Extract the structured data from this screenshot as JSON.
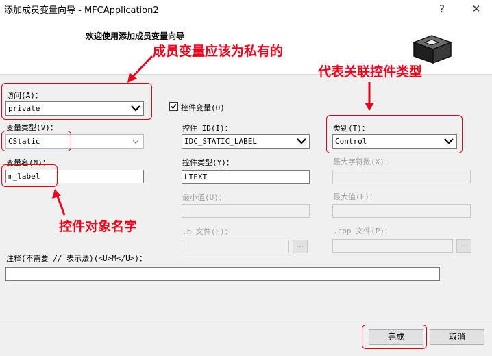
{
  "window": {
    "title": "添加成员变量向导 - MFCApplication2",
    "help_glyph": "?",
    "close_glyph": "✕"
  },
  "header": {
    "welcome": "欢迎使用添加成员变量向导"
  },
  "annotations": {
    "private_note": "成员变量应该为私有的",
    "category_note": "代表关联控件类型",
    "name_note": "控件对象名字",
    "color": "#e8001c"
  },
  "form": {
    "access_label": "访问(A)：",
    "access_value": "private",
    "var_type_label": "变量类型(V)：",
    "var_type_value": "CStatic",
    "var_name_label": "变量名(N)：",
    "var_name_value": "m_label",
    "control_var_label": "控件变量(O)",
    "control_var_checked": true,
    "control_id_label": "控件 ID(I)：",
    "control_id_value": "IDC_STATIC_LABEL",
    "control_type_label": "控件类型(Y)：",
    "control_type_value": "LTEXT",
    "min_label": "最小值(U)：",
    "h_file_label": ".h 文件(F)：",
    "category_label": "类别(T)：",
    "category_value": "Control",
    "max_chars_label": "最大字符数(X)：",
    "max_label": "最大值(E)：",
    "cpp_file_label": ".cpp 文件(P)：",
    "browse_label": "...",
    "comment_label": "注释(不需要 // 表示法)(<U>M</U>)：",
    "comment_value": ""
  },
  "footer": {
    "finish_label": "完成",
    "cancel_label": "取消"
  }
}
